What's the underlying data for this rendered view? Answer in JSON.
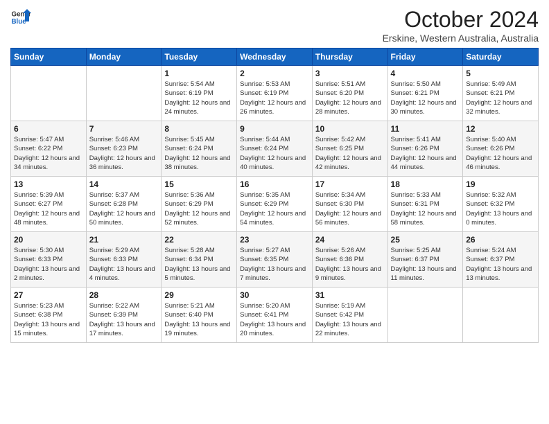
{
  "header": {
    "logo_general": "General",
    "logo_blue": "Blue",
    "month": "October 2024",
    "location": "Erskine, Western Australia, Australia"
  },
  "days_of_week": [
    "Sunday",
    "Monday",
    "Tuesday",
    "Wednesday",
    "Thursday",
    "Friday",
    "Saturday"
  ],
  "weeks": [
    [
      {
        "day": "",
        "data": ""
      },
      {
        "day": "",
        "data": ""
      },
      {
        "day": "1",
        "data": "Sunrise: 5:54 AM\nSunset: 6:19 PM\nDaylight: 12 hours\nand 24 minutes."
      },
      {
        "day": "2",
        "data": "Sunrise: 5:53 AM\nSunset: 6:19 PM\nDaylight: 12 hours\nand 26 minutes."
      },
      {
        "day": "3",
        "data": "Sunrise: 5:51 AM\nSunset: 6:20 PM\nDaylight: 12 hours\nand 28 minutes."
      },
      {
        "day": "4",
        "data": "Sunrise: 5:50 AM\nSunset: 6:21 PM\nDaylight: 12 hours\nand 30 minutes."
      },
      {
        "day": "5",
        "data": "Sunrise: 5:49 AM\nSunset: 6:21 PM\nDaylight: 12 hours\nand 32 minutes."
      }
    ],
    [
      {
        "day": "6",
        "data": "Sunrise: 5:47 AM\nSunset: 6:22 PM\nDaylight: 12 hours\nand 34 minutes."
      },
      {
        "day": "7",
        "data": "Sunrise: 5:46 AM\nSunset: 6:23 PM\nDaylight: 12 hours\nand 36 minutes."
      },
      {
        "day": "8",
        "data": "Sunrise: 5:45 AM\nSunset: 6:24 PM\nDaylight: 12 hours\nand 38 minutes."
      },
      {
        "day": "9",
        "data": "Sunrise: 5:44 AM\nSunset: 6:24 PM\nDaylight: 12 hours\nand 40 minutes."
      },
      {
        "day": "10",
        "data": "Sunrise: 5:42 AM\nSunset: 6:25 PM\nDaylight: 12 hours\nand 42 minutes."
      },
      {
        "day": "11",
        "data": "Sunrise: 5:41 AM\nSunset: 6:26 PM\nDaylight: 12 hours\nand 44 minutes."
      },
      {
        "day": "12",
        "data": "Sunrise: 5:40 AM\nSunset: 6:26 PM\nDaylight: 12 hours\nand 46 minutes."
      }
    ],
    [
      {
        "day": "13",
        "data": "Sunrise: 5:39 AM\nSunset: 6:27 PM\nDaylight: 12 hours\nand 48 minutes."
      },
      {
        "day": "14",
        "data": "Sunrise: 5:37 AM\nSunset: 6:28 PM\nDaylight: 12 hours\nand 50 minutes."
      },
      {
        "day": "15",
        "data": "Sunrise: 5:36 AM\nSunset: 6:29 PM\nDaylight: 12 hours\nand 52 minutes."
      },
      {
        "day": "16",
        "data": "Sunrise: 5:35 AM\nSunset: 6:29 PM\nDaylight: 12 hours\nand 54 minutes."
      },
      {
        "day": "17",
        "data": "Sunrise: 5:34 AM\nSunset: 6:30 PM\nDaylight: 12 hours\nand 56 minutes."
      },
      {
        "day": "18",
        "data": "Sunrise: 5:33 AM\nSunset: 6:31 PM\nDaylight: 12 hours\nand 58 minutes."
      },
      {
        "day": "19",
        "data": "Sunrise: 5:32 AM\nSunset: 6:32 PM\nDaylight: 13 hours\nand 0 minutes."
      }
    ],
    [
      {
        "day": "20",
        "data": "Sunrise: 5:30 AM\nSunset: 6:33 PM\nDaylight: 13 hours\nand 2 minutes."
      },
      {
        "day": "21",
        "data": "Sunrise: 5:29 AM\nSunset: 6:33 PM\nDaylight: 13 hours\nand 4 minutes."
      },
      {
        "day": "22",
        "data": "Sunrise: 5:28 AM\nSunset: 6:34 PM\nDaylight: 13 hours\nand 5 minutes."
      },
      {
        "day": "23",
        "data": "Sunrise: 5:27 AM\nSunset: 6:35 PM\nDaylight: 13 hours\nand 7 minutes."
      },
      {
        "day": "24",
        "data": "Sunrise: 5:26 AM\nSunset: 6:36 PM\nDaylight: 13 hours\nand 9 minutes."
      },
      {
        "day": "25",
        "data": "Sunrise: 5:25 AM\nSunset: 6:37 PM\nDaylight: 13 hours\nand 11 minutes."
      },
      {
        "day": "26",
        "data": "Sunrise: 5:24 AM\nSunset: 6:37 PM\nDaylight: 13 hours\nand 13 minutes."
      }
    ],
    [
      {
        "day": "27",
        "data": "Sunrise: 5:23 AM\nSunset: 6:38 PM\nDaylight: 13 hours\nand 15 minutes."
      },
      {
        "day": "28",
        "data": "Sunrise: 5:22 AM\nSunset: 6:39 PM\nDaylight: 13 hours\nand 17 minutes."
      },
      {
        "day": "29",
        "data": "Sunrise: 5:21 AM\nSunset: 6:40 PM\nDaylight: 13 hours\nand 19 minutes."
      },
      {
        "day": "30",
        "data": "Sunrise: 5:20 AM\nSunset: 6:41 PM\nDaylight: 13 hours\nand 20 minutes."
      },
      {
        "day": "31",
        "data": "Sunrise: 5:19 AM\nSunset: 6:42 PM\nDaylight: 13 hours\nand 22 minutes."
      },
      {
        "day": "",
        "data": ""
      },
      {
        "day": "",
        "data": ""
      }
    ]
  ]
}
